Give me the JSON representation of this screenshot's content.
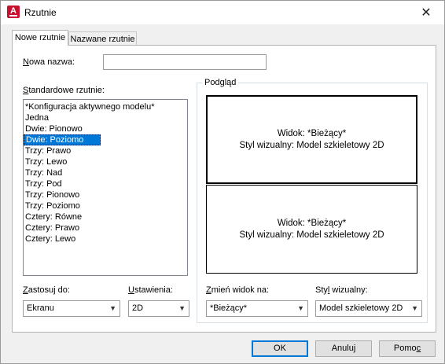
{
  "window": {
    "title": "Rzutnie",
    "app_icon_letter": "A",
    "close_glyph": "✕"
  },
  "tabs": [
    {
      "label": "Nowe rzutnie",
      "active": true
    },
    {
      "label": "Nazwane rzutnie",
      "active": false
    }
  ],
  "new_name": {
    "label_key": "N",
    "label_rest": "owa nazwa:",
    "value": ""
  },
  "standard": {
    "label_key": "S",
    "label_rest": "tandardowe rzutnie:",
    "items": [
      "*Konfiguracja aktywnego modelu*",
      "Jedna",
      "Dwie: Pionowo",
      "Dwie: Poziomo",
      "Trzy: Prawo",
      "Trzy: Lewo",
      "Trzy: Nad",
      "Trzy: Pod",
      "Trzy: Pionowo",
      "Trzy: Poziomo",
      "Cztery: Równe",
      "Cztery: Prawo",
      "Cztery: Lewo"
    ],
    "selected_index": 3
  },
  "preview": {
    "label": "Podgląd",
    "panes": [
      {
        "view": "Widok: *Bieżący*",
        "style": "Styl wizualny: Model szkieletowy 2D"
      },
      {
        "view": "Widok: *Bieżący*",
        "style": "Styl wizualny: Model szkieletowy 2D"
      }
    ]
  },
  "apply_to": {
    "label_key": "Z",
    "label_rest": "astosuj do:",
    "value": "Ekranu"
  },
  "setup": {
    "label_key": "U",
    "label_rest": "stawienia:",
    "value": "2D"
  },
  "change_view": {
    "label_key": "Z",
    "label_rest": "mień widok na:",
    "value": "*Bieżący*"
  },
  "visual_style": {
    "label_prefix": "Sty",
    "label_key": "l",
    "label_rest": " wizualny:",
    "value": "Model szkieletowy 2D"
  },
  "buttons": {
    "ok": "OK",
    "cancel": "Anuluj",
    "help_prefix": "Pomo",
    "help_key": "c"
  }
}
